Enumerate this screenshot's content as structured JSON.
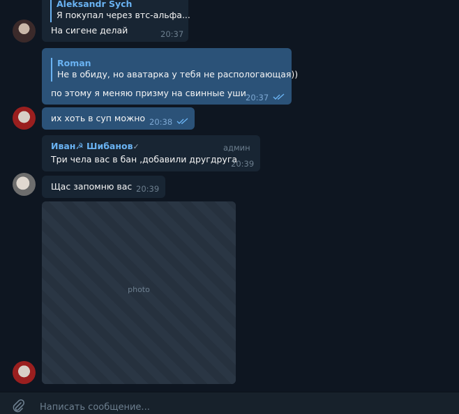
{
  "messages": {
    "m1": {
      "reply_name": "Aleksandr Sych",
      "reply_text": "Я покупал через втс-альфа...",
      "text": "На сигене делай",
      "time": "20:37"
    },
    "m2": {
      "reply_name": "Roman",
      "reply_text": "Не в обиду, но аватарка у тебя не распологающая))",
      "text": "по этому я меняю призму на свинные уши",
      "time": "20:37",
      "read": true
    },
    "m3": {
      "text": "их хоть в суп можно",
      "time": "20:38",
      "read": true
    },
    "m4": {
      "sender": "Иван☭ Шибанов",
      "sender_badge": "✓",
      "role": "админ",
      "text": "Три чела вас в бан ,добавили другдруга",
      "time": "20:39"
    },
    "m5": {
      "text": "Щас запомню вас",
      "time": "20:39"
    },
    "m6": {
      "type": "photo",
      "placeholder": "photo"
    }
  },
  "composer": {
    "placeholder": "Написать сообщение..."
  },
  "icons": {
    "attach": "paperclip-icon",
    "read_checks": "double-check-icon"
  },
  "colors": {
    "background": "#0e1621",
    "incoming": "#182533",
    "outgoing": "#2b5278",
    "accent": "#6ab3f3"
  }
}
